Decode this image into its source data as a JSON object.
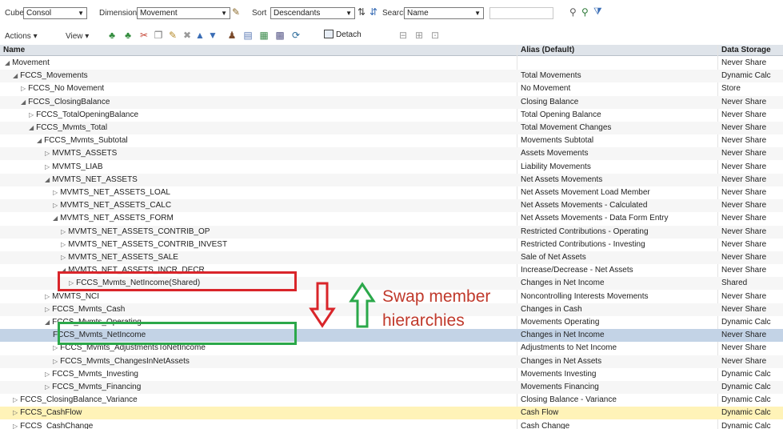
{
  "toolbar": {
    "cube_label": "Cube",
    "cube_value": "Consol",
    "dimension_label": "Dimension",
    "dimension_value": "Movement",
    "sort_label": "Sort",
    "sort_value": "Descendants",
    "search_label": "Search",
    "search_value": "Name",
    "actions_label": "Actions ▾",
    "view_label": "View ▾",
    "detach_label": "Detach"
  },
  "columns": {
    "name": "Name",
    "alias": "Alias (Default)",
    "storage": "Data Storage"
  },
  "rows": [
    {
      "name": "Movement",
      "alias": "",
      "storage": "Never Share"
    },
    {
      "name": "FCCS_Movements",
      "alias": "Total Movements",
      "storage": "Dynamic Calc"
    },
    {
      "name": "FCCS_No Movement",
      "alias": "No Movement",
      "storage": "Store"
    },
    {
      "name": "FCCS_ClosingBalance",
      "alias": "Closing Balance",
      "storage": "Never Share"
    },
    {
      "name": "FCCS_TotalOpeningBalance",
      "alias": "Total Opening Balance",
      "storage": "Never Share"
    },
    {
      "name": "FCCS_Mvmts_Total",
      "alias": "Total Movement Changes",
      "storage": "Never Share"
    },
    {
      "name": "FCCS_Mvmts_Subtotal",
      "alias": "Movements Subtotal",
      "storage": "Never Share"
    },
    {
      "name": "MVMTS_ASSETS",
      "alias": "Assets Movements",
      "storage": "Never Share"
    },
    {
      "name": "MVMTS_LIAB",
      "alias": "Liability Movements",
      "storage": "Never Share"
    },
    {
      "name": "MVMTS_NET_ASSETS",
      "alias": "Net Assets Movements",
      "storage": "Never Share"
    },
    {
      "name": "MVMTS_NET_ASSETS_LOAL",
      "alias": "Net Assets Movement Load Member",
      "storage": "Never Share"
    },
    {
      "name": "MVMTS_NET_ASSETS_CALC",
      "alias": "Net Assets Movements - Calculated",
      "storage": "Never Share"
    },
    {
      "name": "MVMTS_NET_ASSETS_FORM",
      "alias": "Net Assets Movements - Data Form Entry",
      "storage": "Never Share"
    },
    {
      "name": "MVMTS_NET_ASSETS_CONTRIB_OP",
      "alias": "Restricted Contributions - Operating",
      "storage": "Never Share"
    },
    {
      "name": "MVMTS_NET_ASSETS_CONTRIB_INVEST",
      "alias": "Restricted Contributions - Investing",
      "storage": "Never Share"
    },
    {
      "name": "MVMTS_NET_ASSETS_SALE",
      "alias": "Sale of Net Assets",
      "storage": "Never Share"
    },
    {
      "name": "MVMTS_NET_ASSETS_INCR_DECR",
      "alias": "Increase/Decrease - Net Assets",
      "storage": "Never Share"
    },
    {
      "name": "FCCS_Mvmts_NetIncome(Shared)",
      "alias": "Changes in Net Income",
      "storage": "Shared"
    },
    {
      "name": "MVMTS_NCI",
      "alias": "Noncontrolling Interests Movements",
      "storage": "Never Share"
    },
    {
      "name": "FCCS_Mvmts_Cash",
      "alias": "Changes in Cash",
      "storage": "Never Share"
    },
    {
      "name": "FCCS_Mvmts_Operating",
      "alias": "Movements Operating",
      "storage": "Dynamic Calc"
    },
    {
      "name": "FCCS_Mvmts_NetIncome",
      "alias": "Changes in Net Income",
      "storage": "Never Share"
    },
    {
      "name": "FCCS_Mvmts_AdjustmentsToNetIncome",
      "alias": "Adjustments to Net Income",
      "storage": "Never Share"
    },
    {
      "name": "FCCS_Mvmts_ChangesInNetAssets",
      "alias": "Changes in Net Assets",
      "storage": "Never Share"
    },
    {
      "name": "FCCS_Mvmts_Investing",
      "alias": "Movements Investing",
      "storage": "Dynamic Calc"
    },
    {
      "name": "FCCS_Mvmts_Financing",
      "alias": "Movements Financing",
      "storage": "Dynamic Calc"
    },
    {
      "name": "FCCS_ClosingBalance_Variance",
      "alias": "Closing Balance - Variance",
      "storage": "Dynamic Calc"
    },
    {
      "name": "FCCS_CashFlow",
      "alias": "Cash Flow",
      "storage": "Dynamic Calc"
    },
    {
      "name": "FCCS_CashChange",
      "alias": "Cash Change",
      "storage": "Dynamic Calc"
    }
  ],
  "annotation": {
    "line1": "Swap member",
    "line2": "hierarchies"
  },
  "colors": {
    "red": "#d9252a",
    "green": "#2ba84a",
    "selected_row": "#c3d3e6",
    "highlighted_row": "#fff3b8",
    "annotation_text": "#c0392b"
  }
}
